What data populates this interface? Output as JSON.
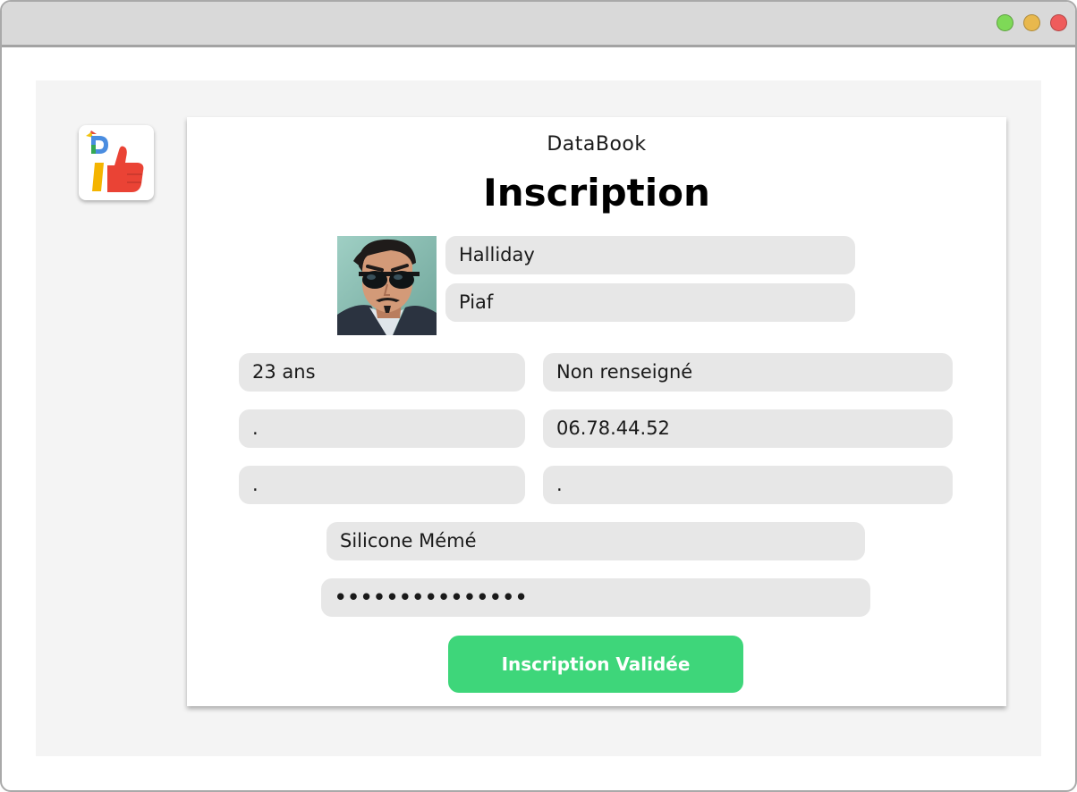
{
  "window": {
    "controls": [
      "maximize",
      "minimize",
      "close"
    ],
    "colors": {
      "maximize": "#7ed957",
      "minimize": "#e8b84d",
      "close": "#ef5c5c"
    }
  },
  "logo": {
    "icon": "thumbs-up-icon",
    "letter": "D"
  },
  "form": {
    "brand": "DataBook",
    "heading": "Inscription",
    "avatar_icon": "avatar-sunglasses-man",
    "fields": {
      "last_name": "Halliday",
      "first_name": "Piaf",
      "age": "23 ans",
      "gender": "Non renseigné",
      "field_r2_left": ".",
      "phone": "06.78.44.52",
      "field_r3_left": ".",
      "field_r3_right": ".",
      "username": "Silicone Mémé",
      "password": "•••••••••••••••"
    },
    "submit_label": "Inscription Validée",
    "accent_color": "#3ed67a"
  }
}
